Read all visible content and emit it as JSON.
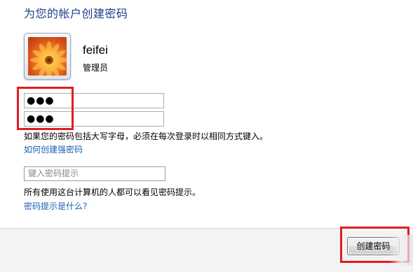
{
  "dialog": {
    "heading": "为您的帐户创建密码"
  },
  "account": {
    "username": "feifei",
    "role": "管理员"
  },
  "fields": {
    "new_password_value": "●●●",
    "confirm_password_value": "●●●",
    "password_hint_placeholder": "键入密码提示"
  },
  "messages": {
    "case_warning": "如果您的密码包括大写字母，必须在每次登录时以相同方式键入。",
    "hint_notice": "所有使用这台计算机的人都可以看见密码提示。"
  },
  "links": {
    "strong_password": "如何创建强密码",
    "what_is_hint": "密码提示是什么?"
  },
  "buttons": {
    "create_password": "创建密码"
  },
  "colors": {
    "heading": "#1e3f8c",
    "link": "#1a5fb4",
    "highlight": "#e31b23"
  }
}
